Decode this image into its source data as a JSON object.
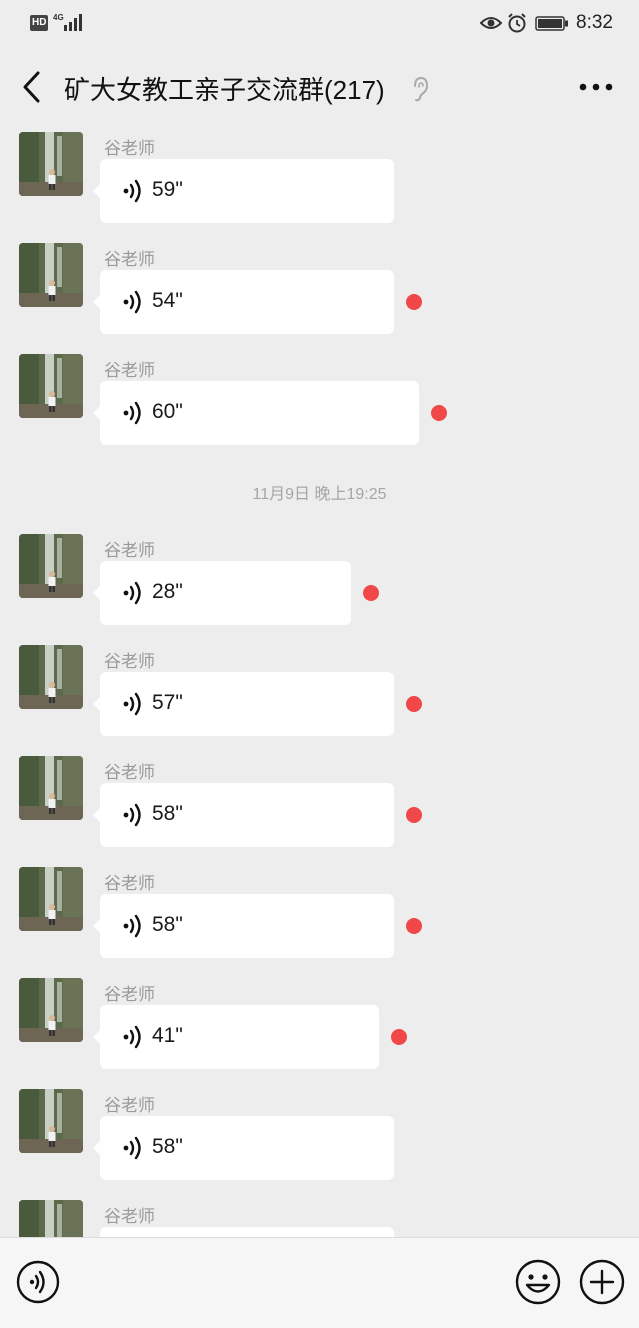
{
  "status_bar": {
    "hd_label": "HD",
    "network_label": "4G",
    "time": "8:32",
    "icons": [
      "signal-icon",
      "eye-icon",
      "alarm-icon",
      "battery-icon"
    ]
  },
  "header": {
    "title": "矿大女教工亲子交流群(217)",
    "icons": [
      "back-icon",
      "earpiece-icon",
      "more-icon"
    ]
  },
  "chat": {
    "timestamp": "11月9日 晚上19:25",
    "messages": [
      {
        "sender": "谷老师",
        "duration": "59\"",
        "unread": false
      },
      {
        "sender": "谷老师",
        "duration": "54\"",
        "unread": true
      },
      {
        "sender": "谷老师",
        "duration": "60\"",
        "unread": true
      },
      {
        "sender": "谷老师",
        "duration": "28\"",
        "unread": true
      },
      {
        "sender": "谷老师",
        "duration": "57\"",
        "unread": true
      },
      {
        "sender": "谷老师",
        "duration": "58\"",
        "unread": true
      },
      {
        "sender": "谷老师",
        "duration": "58\"",
        "unread": true
      },
      {
        "sender": "谷老师",
        "duration": "41\"",
        "unread": true
      },
      {
        "sender": "谷老师",
        "duration": "58\"",
        "unread": false
      },
      {
        "sender": "谷老师",
        "duration": "",
        "unread": false
      }
    ]
  },
  "input_bar": {
    "placeholder": "",
    "icons": [
      "voice-input-icon",
      "emoji-icon",
      "plus-icon"
    ]
  },
  "colors": {
    "background": "#ededed",
    "bubble": "#ffffff",
    "unread_dot": "#f04848",
    "sender_text": "#9a9a9a"
  }
}
